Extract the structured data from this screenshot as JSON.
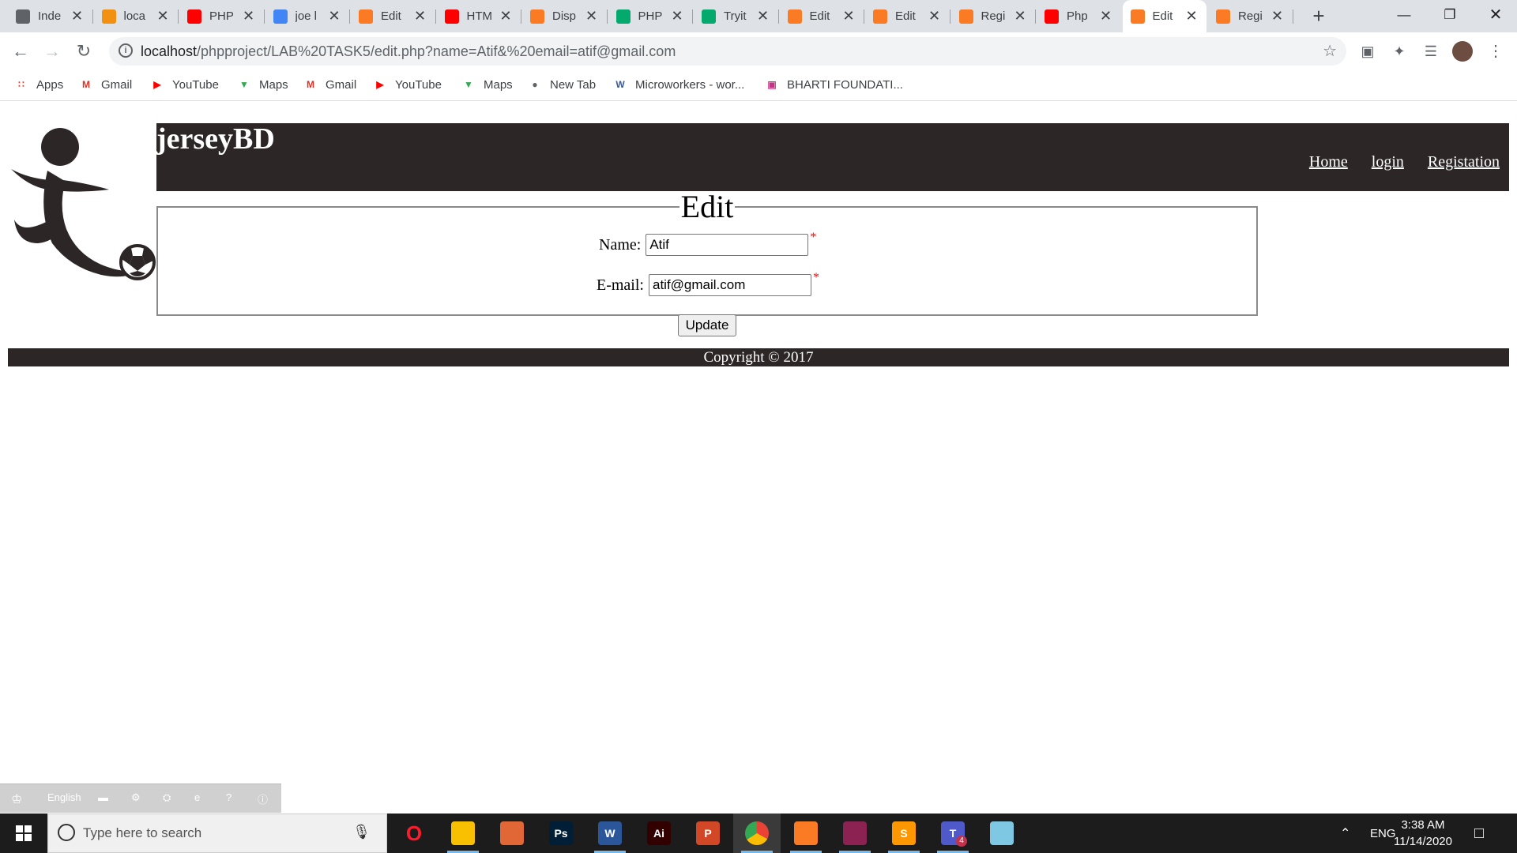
{
  "browser": {
    "tabs": [
      {
        "title": "Inde",
        "icon": "globe-icon",
        "color": "#5f6368"
      },
      {
        "title": "loca",
        "icon": "phpmyadmin-icon",
        "color": "#f29111"
      },
      {
        "title": "PHP",
        "icon": "youtube-icon",
        "color": "#ff0000"
      },
      {
        "title": "joe l",
        "icon": "google-icon",
        "color": "#4285f4"
      },
      {
        "title": "Edit",
        "icon": "xampp-icon",
        "color": "#fb7a24"
      },
      {
        "title": "HTM",
        "icon": "youtube-icon",
        "color": "#ff0000"
      },
      {
        "title": "Disp",
        "icon": "xampp-icon",
        "color": "#fb7a24"
      },
      {
        "title": "PHP",
        "icon": "w3schools-icon",
        "color": "#04aa6d"
      },
      {
        "title": "Tryit",
        "icon": "w3schools-icon",
        "color": "#04aa6d"
      },
      {
        "title": "Edit",
        "icon": "xampp-icon",
        "color": "#fb7a24"
      },
      {
        "title": "Edit",
        "icon": "xampp-icon",
        "color": "#fb7a24"
      },
      {
        "title": "Regi",
        "icon": "xampp-icon",
        "color": "#fb7a24"
      },
      {
        "title": "Php",
        "icon": "youtube-icon",
        "color": "#ff0000"
      },
      {
        "title": "Edit",
        "icon": "xampp-icon",
        "color": "#fb7a24",
        "active": true
      },
      {
        "title": "Regi",
        "icon": "xampp-icon",
        "color": "#fb7a24"
      }
    ],
    "url_host": "localhost",
    "url_path": "/phpproject/LAB%20TASK5/edit.php?name=Atif&%20email=atif@gmail.com",
    "bookmarks": [
      {
        "label": "Apps",
        "icon": "apps-grid-icon"
      },
      {
        "label": "Gmail",
        "icon": "gmail-icon"
      },
      {
        "label": "YouTube",
        "icon": "youtube-icon"
      },
      {
        "label": "Maps",
        "icon": "maps-pin-icon"
      },
      {
        "label": "Gmail",
        "icon": "gmail-icon"
      },
      {
        "label": "YouTube",
        "icon": "youtube-icon"
      },
      {
        "label": "Maps",
        "icon": "maps-pin-icon"
      },
      {
        "label": "New Tab",
        "icon": "globe-icon"
      },
      {
        "label": "Microworkers - wor...",
        "icon": "microworkers-icon"
      },
      {
        "label": "BHARTI FOUNDATI...",
        "icon": "instagram-icon"
      }
    ]
  },
  "site": {
    "brand": "jerseyBD",
    "nav": [
      "Home",
      "login",
      "Registation"
    ],
    "form_legend": "Edit",
    "name_label": "Name:",
    "name_value": "Atif",
    "email_label": "E-mail:",
    "email_value": "atif@gmail.com",
    "required_mark": "*",
    "submit_label": "Update",
    "footer": "Copyright © 2017"
  },
  "langbar": {
    "language": "English"
  },
  "taskbar": {
    "search_placeholder": "Type here to search",
    "apps": [
      {
        "name": "opera-icon",
        "glyph": "O",
        "color": "#ff1b2d"
      },
      {
        "name": "file-explorer-icon",
        "glyph": "",
        "color": "#f8c000"
      },
      {
        "name": "matlab-icon",
        "glyph": "",
        "color": "#e16737"
      },
      {
        "name": "photoshop-icon",
        "glyph": "Ps",
        "color": "#001e36"
      },
      {
        "name": "word-icon",
        "glyph": "W",
        "color": "#2b579a"
      },
      {
        "name": "illustrator-icon",
        "glyph": "Ai",
        "color": "#330000"
      },
      {
        "name": "powerpoint-icon",
        "glyph": "P",
        "color": "#d24726"
      },
      {
        "name": "chrome-icon",
        "glyph": "",
        "color": "#4285f4"
      },
      {
        "name": "xampp-icon",
        "glyph": "",
        "color": "#fb7a24"
      },
      {
        "name": "winrar-icon",
        "glyph": "",
        "color": "#8b2252"
      },
      {
        "name": "sublime-icon",
        "glyph": "S",
        "color": "#ff9800"
      },
      {
        "name": "teams-icon",
        "glyph": "T",
        "color": "#5059c9"
      },
      {
        "name": "notepad-icon",
        "glyph": "",
        "color": "#7ec8e3"
      }
    ],
    "language": "ENG",
    "time": "3:38 AM",
    "date": "11/14/2020",
    "teams_badge": "4"
  }
}
